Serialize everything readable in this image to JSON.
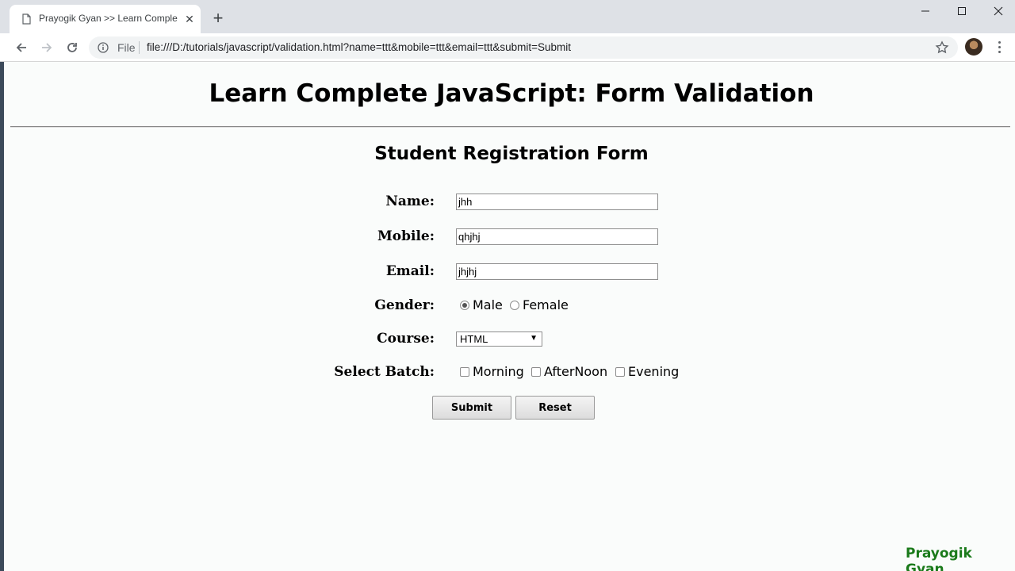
{
  "browser": {
    "tab_title": "Prayogik Gyan >> Learn Comple",
    "new_tab_symbol": "+",
    "close_symbol": "✕",
    "file_label": "File",
    "url": "file:///D:/tutorials/javascript/validation.html?name=ttt&mobile=ttt&email=ttt&submit=Submit"
  },
  "page": {
    "title": "Learn Complete JavaScript: Form Validation",
    "form_title": "Student Registration Form",
    "footer_brand": "Prayogik Gyan"
  },
  "form": {
    "name_label": "Name:",
    "name_value": "jhh",
    "mobile_label": "Mobile:",
    "mobile_value": "qhjhj",
    "email_label": "Email:",
    "email_value": "jhjhj",
    "gender_label": "Gender:",
    "gender_options": [
      "Male",
      "Female"
    ],
    "gender_selected": "Male",
    "course_label": "Course:",
    "course_value": "HTML",
    "batch_label": "Select Batch:",
    "batch_options": [
      "Morning",
      "AfterNoon",
      "Evening"
    ],
    "submit_label": "Submit",
    "reset_label": "Reset"
  }
}
